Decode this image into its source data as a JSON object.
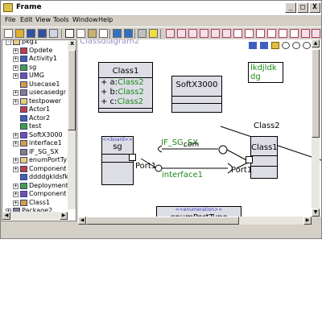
{
  "window": {
    "title": "Frame",
    "minimize": "_",
    "maximize": "□",
    "close": "X"
  },
  "menu": [
    "File",
    "Edit",
    "View",
    "Tools",
    "Window",
    "Help"
  ],
  "tree": {
    "close_glyph": "x",
    "items": [
      {
        "label": "pkg1",
        "indent": 0,
        "exp": "-"
      },
      {
        "label": "Opdete",
        "indent": 1,
        "exp": "+"
      },
      {
        "label": "Activity1",
        "indent": 1,
        "exp": "+"
      },
      {
        "label": "sg",
        "indent": 1,
        "exp": "+"
      },
      {
        "label": "UMG",
        "indent": 1,
        "exp": "+"
      },
      {
        "label": "Usecase1",
        "indent": 1,
        "exp": ""
      },
      {
        "label": "usecasedgr",
        "indent": 1,
        "exp": "+"
      },
      {
        "label": "testpower",
        "indent": 1,
        "exp": "+"
      },
      {
        "label": "Actor1",
        "indent": 1,
        "exp": ""
      },
      {
        "label": "Actor2",
        "indent": 1,
        "exp": ""
      },
      {
        "label": "test",
        "indent": 1,
        "exp": ""
      },
      {
        "label": "SoftX3000",
        "indent": 1,
        "exp": "+"
      },
      {
        "label": "interface1",
        "indent": 1,
        "exp": "+"
      },
      {
        "label": "IF_SG_SX",
        "indent": 1,
        "exp": ""
      },
      {
        "label": "enumPortTy",
        "indent": 1,
        "exp": "+"
      },
      {
        "label": "Component",
        "indent": 1,
        "exp": "+"
      },
      {
        "label": "ddddgkldsfk",
        "indent": 1,
        "exp": ""
      },
      {
        "label": "Deployment",
        "indent": 1,
        "exp": "+"
      },
      {
        "label": "Component",
        "indent": 1,
        "exp": "+"
      },
      {
        "label": "Class1",
        "indent": 1,
        "exp": "+"
      },
      {
        "label": "Package2",
        "indent": 0,
        "exp": "+"
      }
    ]
  },
  "diagram": {
    "title": "Classdiagram2",
    "class1": {
      "name": "Class1",
      "attrs": [
        {
          "prefix": "+ a:",
          "type": "Class2"
        },
        {
          "prefix": "+ b:",
          "type": "Class2"
        },
        {
          "prefix": "+ c:",
          "type": "Class2"
        }
      ]
    },
    "softx": {
      "name": "SoftX3000"
    },
    "note": {
      "text": "lkdjldk dg"
    },
    "sg": {
      "stereotype": "<<board>>",
      "name": "sg"
    },
    "class1b": {
      "name": "Class1"
    },
    "enum": {
      "stereotype": "<<enumeration>>",
      "name": "enumPortType"
    },
    "labels": {
      "class2": "Class2",
      "if_sg_sx": "IF_SG_SX",
      "com": "com",
      "port1_left": "Port1",
      "interface1": "interface1",
      "port1_right": "Port1"
    }
  }
}
